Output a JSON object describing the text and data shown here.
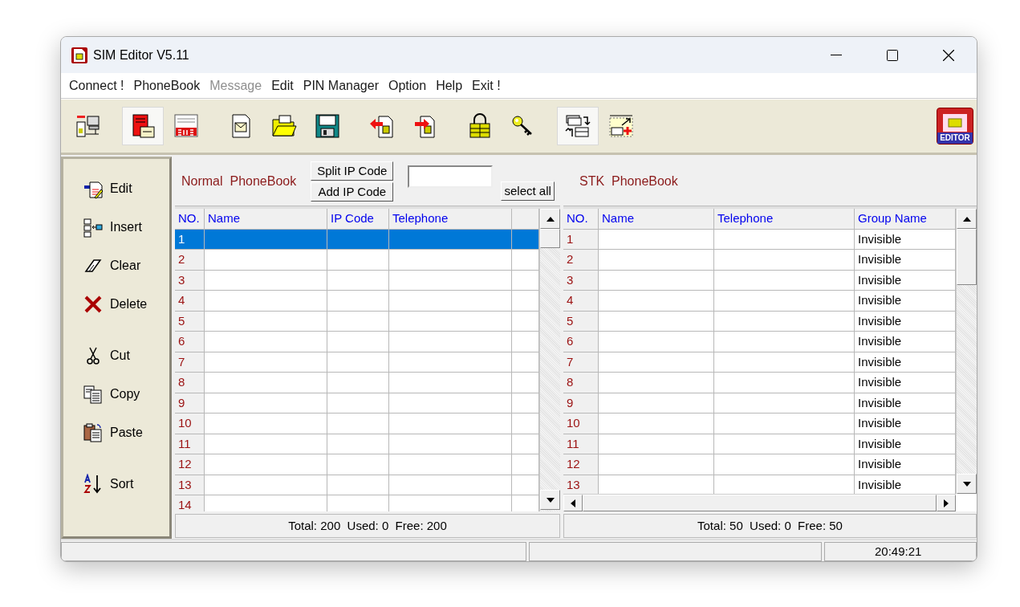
{
  "window": {
    "title": "SIM Editor V5.11"
  },
  "menu": [
    {
      "label": "Connect !",
      "disabled": false
    },
    {
      "label": "PhoneBook",
      "disabled": false
    },
    {
      "label": "Message",
      "disabled": true
    },
    {
      "label": "Edit",
      "disabled": false
    },
    {
      "label": "PIN Manager",
      "disabled": false
    },
    {
      "label": "Option",
      "disabled": false
    },
    {
      "label": "Help",
      "disabled": false
    },
    {
      "label": "Exit !",
      "disabled": false
    }
  ],
  "toolbar": {
    "groups": [
      [
        {
          "kind": "connect",
          "pressed": false
        }
      ],
      [
        {
          "kind": "phonebook",
          "pressed": true
        },
        {
          "kind": "sms",
          "pressed": false
        }
      ],
      [
        {
          "kind": "message",
          "pressed": false
        },
        {
          "kind": "open",
          "pressed": false
        },
        {
          "kind": "save",
          "pressed": false
        }
      ],
      [
        {
          "kind": "sim-out",
          "pressed": false
        },
        {
          "kind": "sim-in",
          "pressed": false
        }
      ],
      [
        {
          "kind": "lock",
          "pressed": false
        },
        {
          "kind": "key",
          "pressed": false
        }
      ],
      [
        {
          "kind": "swap",
          "pressed": true
        },
        {
          "kind": "add-field",
          "pressed": false
        }
      ]
    ],
    "logo": "EDITOR"
  },
  "sidebar": {
    "groups": [
      [
        {
          "kind": "edit",
          "label": "Edit"
        },
        {
          "kind": "insert",
          "label": "Insert"
        },
        {
          "kind": "clear",
          "label": "Clear"
        },
        {
          "kind": "delete",
          "label": "Delete"
        }
      ],
      [
        {
          "kind": "cut",
          "label": "Cut"
        },
        {
          "kind": "copy",
          "label": "Copy"
        },
        {
          "kind": "paste",
          "label": "Paste"
        }
      ],
      [
        {
          "kind": "sort",
          "label": "Sort"
        }
      ]
    ]
  },
  "normal_phonebook": {
    "title": "Normal  PhoneBook",
    "buttons": [
      "Split IP Code",
      "Add IP Code"
    ],
    "select_all": "select all",
    "columns": [
      "NO.",
      "Name",
      "IP Code",
      "Telephone"
    ],
    "rows": [
      {
        "no": "1",
        "selected": true
      },
      {
        "no": "2",
        "selected": false
      },
      {
        "no": "3",
        "selected": false
      },
      {
        "no": "4",
        "selected": false
      },
      {
        "no": "5",
        "selected": false
      },
      {
        "no": "6",
        "selected": false
      },
      {
        "no": "7",
        "selected": false
      },
      {
        "no": "8",
        "selected": false
      },
      {
        "no": "9",
        "selected": false
      },
      {
        "no": "10",
        "selected": false
      },
      {
        "no": "11",
        "selected": false
      },
      {
        "no": "12",
        "selected": false
      },
      {
        "no": "13",
        "selected": false
      },
      {
        "no": "14",
        "selected": false
      }
    ],
    "summary": "Total: 200  Used: 0  Free: 200"
  },
  "stk_phonebook": {
    "title": "STK  PhoneBook",
    "columns": [
      "NO.",
      "Name",
      "Telephone",
      "Group Name"
    ],
    "rows": [
      {
        "no": "1",
        "group": "Invisible"
      },
      {
        "no": "2",
        "group": "Invisible"
      },
      {
        "no": "3",
        "group": "Invisible"
      },
      {
        "no": "4",
        "group": "Invisible"
      },
      {
        "no": "5",
        "group": "Invisible"
      },
      {
        "no": "6",
        "group": "Invisible"
      },
      {
        "no": "7",
        "group": "Invisible"
      },
      {
        "no": "8",
        "group": "Invisible"
      },
      {
        "no": "9",
        "group": "Invisible"
      },
      {
        "no": "10",
        "group": "Invisible"
      },
      {
        "no": "11",
        "group": "Invisible"
      },
      {
        "no": "12",
        "group": "Invisible"
      },
      {
        "no": "13",
        "group": "Invisible"
      }
    ],
    "summary": "Total: 50  Used: 0  Free: 50"
  },
  "status_bar": {
    "time": "20:49:21"
  }
}
